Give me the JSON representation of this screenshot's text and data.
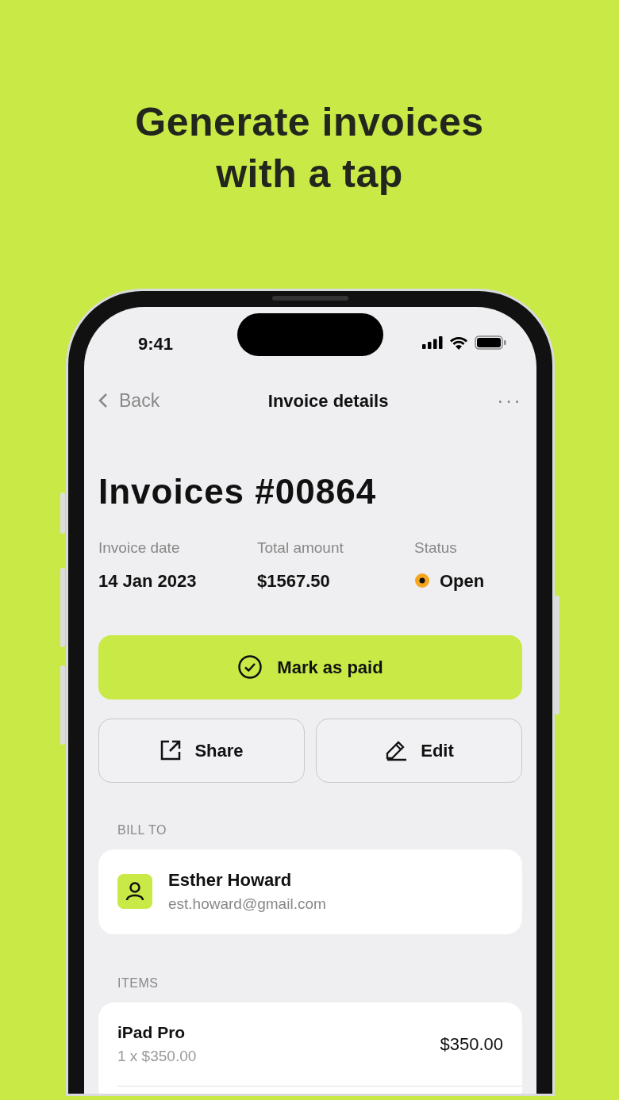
{
  "headline": "Generate invoices with a tap",
  "status_bar": {
    "time": "9:41"
  },
  "nav": {
    "back": "Back",
    "title": "Invoice details",
    "more": "···"
  },
  "invoice": {
    "title": "Invoices #00864",
    "fields": [
      {
        "label": "Invoice date",
        "value": "14 Jan 2023"
      },
      {
        "label": "Total amount",
        "value": "$1567.50"
      },
      {
        "label": "Status",
        "value": "Open",
        "color": "#f7a51c"
      }
    ]
  },
  "actions": {
    "primary": "Mark as paid",
    "secondary": [
      {
        "kind": "share",
        "label": "Share"
      },
      {
        "kind": "edit",
        "label": "Edit"
      }
    ]
  },
  "bill_to": {
    "heading": "BILL TO",
    "name": "Esther Howard",
    "email": "est.howard@gmail.com"
  },
  "items": {
    "heading": "ITEMS",
    "rows": [
      {
        "name": "iPad Pro",
        "detail": "1 x $350.00",
        "amount": "$350.00"
      }
    ]
  }
}
